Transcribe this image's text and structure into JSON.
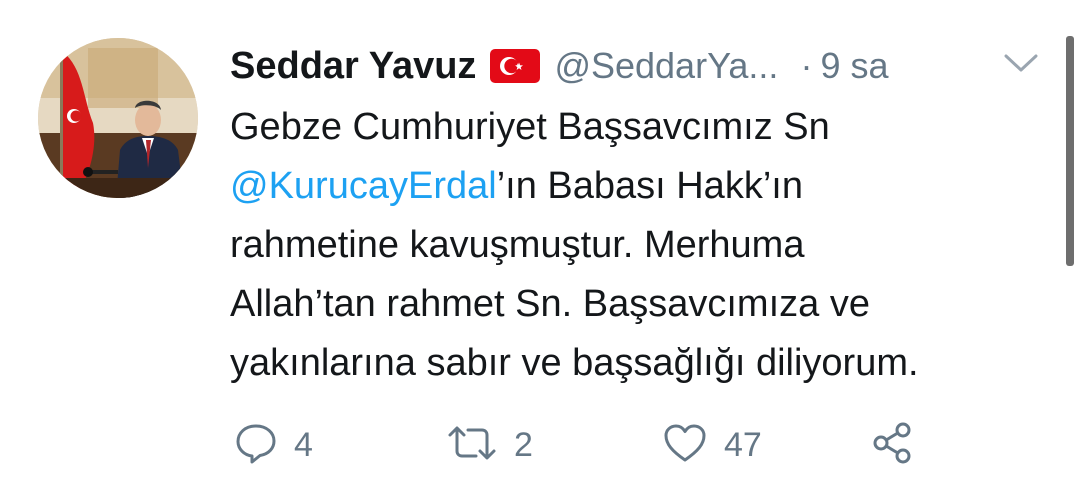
{
  "tweet": {
    "author_name": "Seddar Yavuz",
    "flag_icon": "turkey-flag-icon",
    "handle": "@SeddarYa...",
    "separator": "·",
    "time": "9 sa",
    "text_lines": [
      {
        "pre": "Gebze Cumhuriyet Başsavcımız Sn",
        "mention": "",
        "post": ""
      },
      {
        "pre": "",
        "mention": "@KurucayErdal",
        "post": "’ın Babası Hakk’ın"
      },
      {
        "pre": "rahmetine kavuşmuştur. Merhuma",
        "mention": "",
        "post": ""
      },
      {
        "pre": "Allah’tan rahmet Sn. Başsavcımıza ve",
        "mention": "",
        "post": ""
      },
      {
        "pre": "yakınlarına sabır ve başsağlığı diliyorum.",
        "mention": "",
        "post": ""
      }
    ],
    "actions": {
      "reply_count": "4",
      "retweet_count": "2",
      "like_count": "47"
    }
  },
  "colors": {
    "text": "#14171a",
    "secondary": "#657786",
    "link": "#1da1f2",
    "flag_red": "#e30a17"
  }
}
